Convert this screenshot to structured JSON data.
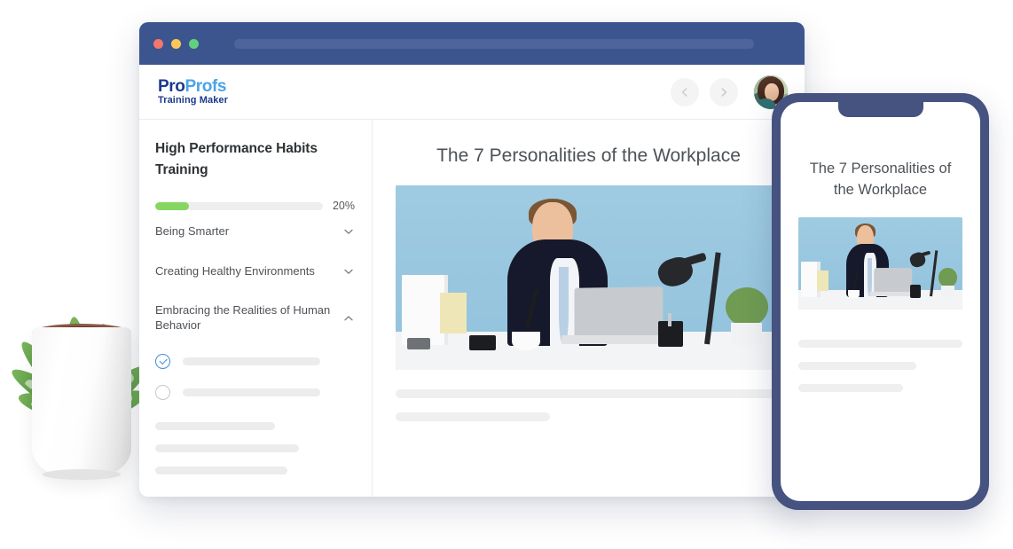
{
  "browser": {
    "traffic_lights": [
      "close",
      "minimize",
      "maximize"
    ],
    "url_value": "",
    "url_placeholder": ""
  },
  "app": {
    "logo": {
      "name_primary": "Pro",
      "name_secondary": "Profs",
      "tagline": "Training Maker",
      "color_primary": "#1b3a8c",
      "color_secondary": "#4aa3e8"
    },
    "nav": {
      "prev_label": "Previous",
      "next_label": "Next"
    },
    "avatar_label": "User profile"
  },
  "sidebar": {
    "course_title": "High Performance Habits Training",
    "progress": {
      "percent": 20,
      "label": "20%",
      "fill_color": "#85d762",
      "track_color": "#eeeeee"
    },
    "chapters": [
      {
        "label": "Being Smarter",
        "expanded": false,
        "chevron": "chevron-down-icon"
      },
      {
        "label": "Creating Healthy Environments",
        "expanded": false,
        "chevron": "chevron-down-icon"
      },
      {
        "label": "Embracing the Realities of Human Behavior",
        "expanded": true,
        "chevron": "chevron-up-icon"
      }
    ],
    "lessons": [
      {
        "status": "completed",
        "marker": "check-circle-icon",
        "title_placeholder": true
      },
      {
        "status": "not-started",
        "marker": "empty-circle-icon",
        "title_placeholder": true
      }
    ],
    "placeholder_lines": [
      {
        "width_pct": 60
      },
      {
        "width_pct": 72
      },
      {
        "width_pct": 66
      }
    ]
  },
  "main": {
    "slide_title": "The 7 Personalities of the Workplace",
    "hero": {
      "alt": "Businessman in dark suit seated at a white desk with a laptop, desk lamp, coffee cup and potted plant against a light blue background",
      "background_color": "#9cc9e0"
    },
    "placeholder_lines": [
      {
        "width_pct": 100
      },
      {
        "width_pct": 40
      }
    ]
  },
  "phone": {
    "slide_title": "The 7 Personalities of the Workplace",
    "hero": {
      "alt": "Businessman in dark suit seated at a white desk with a laptop and desk lamp against a light blue background",
      "background_color": "#9cc9e0"
    },
    "placeholder_lines": [
      {
        "width_pct": 100
      },
      {
        "width_pct": 72
      },
      {
        "width_pct": 64
      }
    ],
    "bezel_color": "#46527f"
  },
  "decor": {
    "plant_alt": "Potted aloe succulent in a white ceramic pot"
  }
}
